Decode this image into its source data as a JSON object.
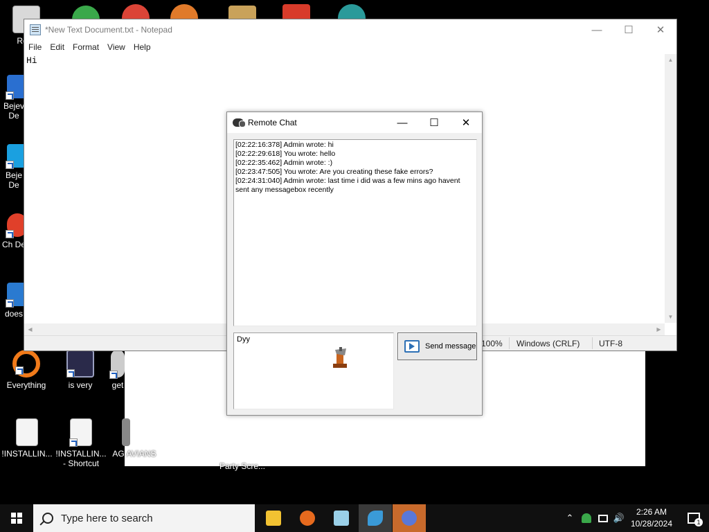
{
  "desktop": {
    "icons": [
      {
        "label": "Recy",
        "icon": "recycle-bin-icon"
      },
      {
        "label": "Bejev De",
        "icon": "bejeweled-icon"
      },
      {
        "label": "Beje De",
        "icon": "bejeweled-icon"
      },
      {
        "label": "Ch De",
        "icon": "chuzzle-icon"
      },
      {
        "label": "does",
        "icon": "app-icon"
      },
      {
        "label": "Everything",
        "icon": "everything-search-icon"
      },
      {
        "label": "is very",
        "icon": "shield-logo-icon"
      },
      {
        "label": "get",
        "icon": "app-icon"
      },
      {
        "label": "!INSTALLIN...",
        "icon": "document-icon"
      },
      {
        "label": "!INSTALLIN... - Shortcut",
        "icon": "document-icon"
      },
      {
        "label": "AG AVIANS",
        "icon": "app-icon"
      },
      {
        "label": "Party Scre...",
        "icon": "app-icon"
      }
    ]
  },
  "notepad": {
    "title": "*New Text Document.txt - Notepad",
    "menu": [
      "File",
      "Edit",
      "Format",
      "View",
      "Help"
    ],
    "content": "Hi",
    "status": {
      "zoom": "100%",
      "line_ending": "Windows (CRLF)",
      "encoding": "UTF-8"
    }
  },
  "chat": {
    "title": "Remote Chat",
    "log": [
      "[02:22:16:378] Admin wrote: hi",
      "[02:22:29:618] You wrote: hello",
      "[02:22:35:462] Admin wrote: :)",
      "[02:23:47:505] You wrote: Are you creating these fake errors?",
      "[02:24:31:040] Admin wrote: last time i did was a few mins ago havent sent any messagebox recently"
    ],
    "input_value": "Dyy",
    "send_label": "Send message"
  },
  "taskbar": {
    "search_placeholder": "Type here to search",
    "apps": [
      "file-explorer-icon",
      "firefox-icon",
      "notepad-icon",
      "remote-app-icon",
      "remote-chat-icon"
    ],
    "clock_time": "2:26 AM",
    "clock_date": "10/28/2024",
    "notification_count": "1"
  },
  "colors": {
    "desktop": "#000000",
    "taskbar": "#101010",
    "active_app": "#c86a2c",
    "send_icon": "#2c6fb5"
  }
}
